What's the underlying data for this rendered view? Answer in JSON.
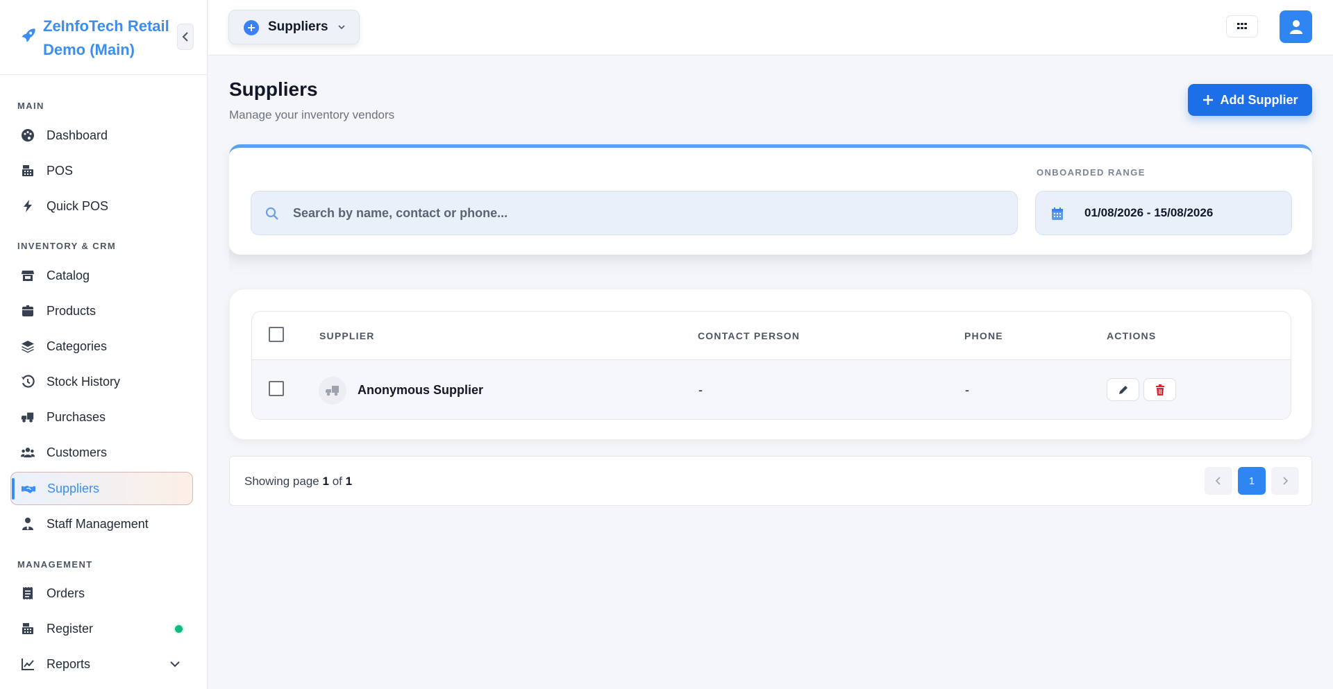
{
  "brand": {
    "name": "ZeInfoTech Retail Demo (Main)",
    "icon": "rocket-icon",
    "accent": "#3b8ef0"
  },
  "sidebar": {
    "sections": [
      {
        "title": "MAIN"
      },
      {
        "title": "INVENTORY & CRM"
      },
      {
        "title": "MANAGEMENT"
      }
    ],
    "items": [
      {
        "label": "Dashboard",
        "icon": "palette-icon"
      },
      {
        "label": "POS",
        "icon": "cash-register-icon"
      },
      {
        "label": "Quick POS",
        "icon": "bolt-icon"
      },
      {
        "label": "Catalog",
        "icon": "store-icon"
      },
      {
        "label": "Products",
        "icon": "box-icon"
      },
      {
        "label": "Categories",
        "icon": "layers-icon"
      },
      {
        "label": "Stock History",
        "icon": "history-icon"
      },
      {
        "label": "Purchases",
        "icon": "truck-icon"
      },
      {
        "label": "Customers",
        "icon": "users-icon"
      },
      {
        "label": "Suppliers",
        "icon": "handshake-icon",
        "active": true
      },
      {
        "label": "Staff Management",
        "icon": "user-tie-icon"
      },
      {
        "label": "Orders",
        "icon": "receipt-icon"
      },
      {
        "label": "Register",
        "icon": "cash-register-icon",
        "status": "online"
      },
      {
        "label": "Reports",
        "icon": "chart-line-icon"
      }
    ]
  },
  "topbar": {
    "context_label": "Suppliers"
  },
  "page": {
    "title": "Suppliers",
    "subtitle": "Manage your inventory vendors",
    "add_button": "Add Supplier"
  },
  "filters": {
    "search_placeholder": "Search by name, contact or phone...",
    "range_label": "ONBOARDED RANGE",
    "range_value": "01/08/2026 - 15/08/2026"
  },
  "table": {
    "columns": [
      "SUPPLIER",
      "CONTACT PERSON",
      "PHONE",
      "ACTIONS"
    ],
    "rows": [
      {
        "supplier": "Anonymous Supplier",
        "contact": "-",
        "phone": "-"
      }
    ]
  },
  "pagination": {
    "prefix": "Showing page",
    "current": "1",
    "of": "of",
    "total": "1",
    "page_button": "1"
  }
}
